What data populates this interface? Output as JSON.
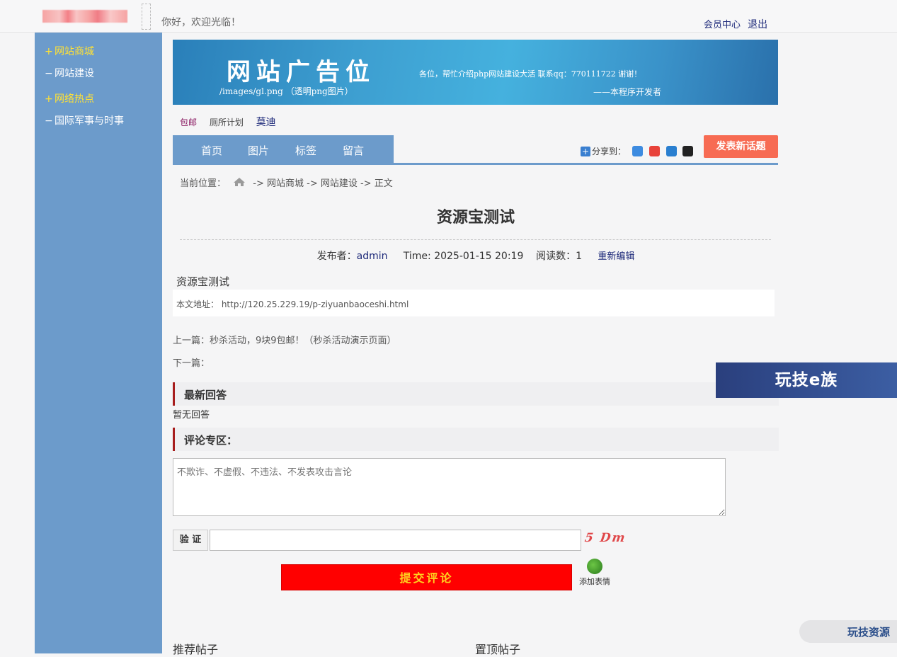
{
  "header": {
    "welcome": "你好，欢迎光临！",
    "member_center": "会员中心",
    "logout": "退出"
  },
  "sidebar": {
    "items": [
      {
        "mark": "+",
        "label": "网站商城",
        "hot": true
      },
      {
        "mark": "−",
        "label": "网站建设",
        "hot": false
      },
      {
        "mark": "+",
        "label": "网络热点",
        "hot": true
      },
      {
        "mark": "−",
        "label": "国际军事与时事",
        "hot": false
      }
    ]
  },
  "banner": {
    "title": "网站广告位",
    "path": "/images/gl.png （透明png图片）",
    "message": "各位，帮忙介绍php网站建设大活  联系qq：770111722 谢谢！",
    "sign": "——本程序开发者"
  },
  "tags": [
    "包邮",
    "厕所计划",
    "莫迪"
  ],
  "nav": {
    "tabs": [
      "首页",
      "图片",
      "标签",
      "留言"
    ],
    "share_label": "分享到：",
    "post_button": "发表新话题"
  },
  "breadcrumb": {
    "prefix": "当前位置：",
    "path": "-> 网站商城 -> 网站建设 -> 正文"
  },
  "article": {
    "title": "资源宝测试",
    "publisher_label": "发布者：",
    "publisher": "admin",
    "time": "Time: 2025-01-15 20:19",
    "reads": "阅读数：1",
    "edit": "重新编辑",
    "body": "资源宝测试",
    "address": "本文地址：  http://120.25.229.19/p-ziyuanbaoceshi.html",
    "prev": "上一篇：秒杀活动，9块9包邮！（秒杀活动演示页面）",
    "next": "下一篇："
  },
  "replies": {
    "heading": "最新回答",
    "empty": "暂无回答"
  },
  "comment": {
    "heading": "评论专区：",
    "placeholder": "不欺诈、不虚假、不违法、不发表攻击言论",
    "verify_label": "验 证",
    "captcha": "5 Dm",
    "submit": "提交评论",
    "emoji": "添加表情"
  },
  "footer": {
    "recommended": "推荐帖子",
    "pinned": "置顶帖子"
  },
  "ads": {
    "float_right": "玩技e族",
    "float_bottom": "玩技资源"
  },
  "colors": {
    "sidebar": "#6c9bcb",
    "hot_link": "#ffe135",
    "submit_bg": "#ff0000",
    "post_button_bg": "#f76b53"
  }
}
